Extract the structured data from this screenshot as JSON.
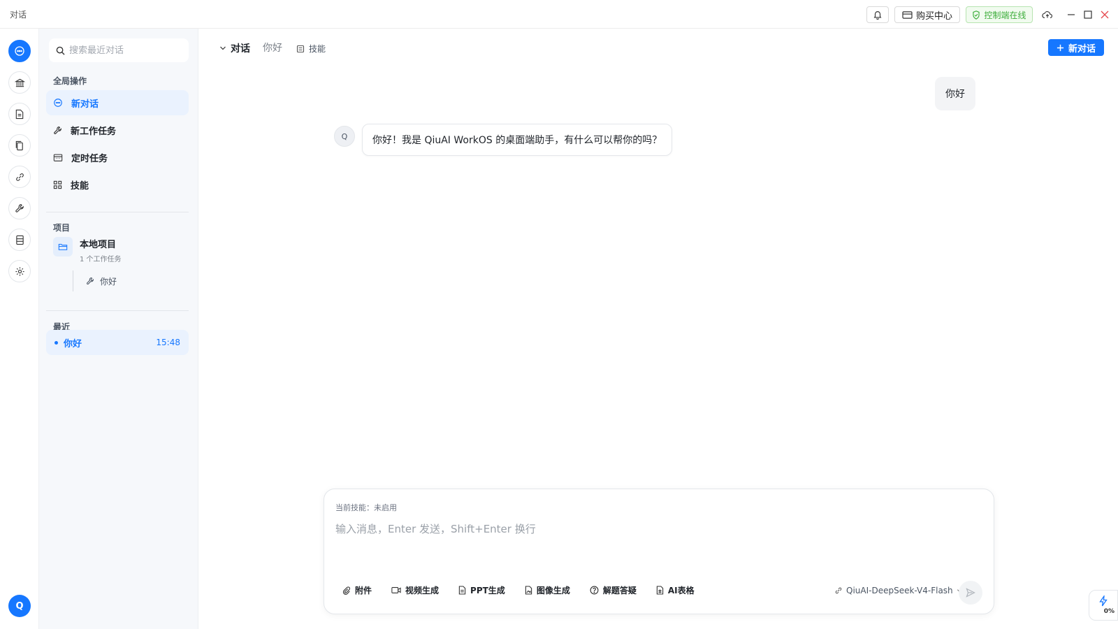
{
  "window": {
    "title": "对话"
  },
  "topbar": {
    "buy_center": "购买中心",
    "console_status": "控制端在线"
  },
  "rail": {
    "avatar_letter": "Q"
  },
  "sidebar": {
    "search_placeholder": "搜索最近对话",
    "global_section": "全局操作",
    "global_items": [
      {
        "label": "新对话",
        "icon": "chat-icon"
      },
      {
        "label": "新工作任务",
        "icon": "wrench-icon"
      },
      {
        "label": "定时任务",
        "icon": "calendar-icon"
      },
      {
        "label": "技能",
        "icon": "grid-icon"
      }
    ],
    "project_section": "项目",
    "project": {
      "name": "本地项目",
      "subtitle": "1 个工作任务",
      "task": "你好"
    },
    "recent_section": "最近",
    "recent": [
      {
        "title": "你好",
        "time": "15:48"
      }
    ]
  },
  "header": {
    "tab_active": "对话",
    "tab_hello": "你好",
    "tab_skills": "技能",
    "new_chat_button": "新对话"
  },
  "messages": [
    {
      "role": "user",
      "text": "你好"
    },
    {
      "role": "assistant",
      "avatar": "Q",
      "text": "你好！我是 QiuAI WorkOS 的桌面端助手，有什么可以帮你的吗？"
    }
  ],
  "composer": {
    "current_skill": "当前技能：未启用",
    "placeholder": "输入消息，Enter 发送，Shift+Enter 换行",
    "tools": [
      "附件",
      "视频生成",
      "PPT生成",
      "图像生成",
      "解题答疑",
      "AI表格"
    ],
    "model": "QiuAI-DeepSeek-V4-Flash"
  },
  "corner_widget": {
    "percent": "0%"
  },
  "colors": {
    "accent": "#1677ff",
    "online": "#3cad3a"
  }
}
